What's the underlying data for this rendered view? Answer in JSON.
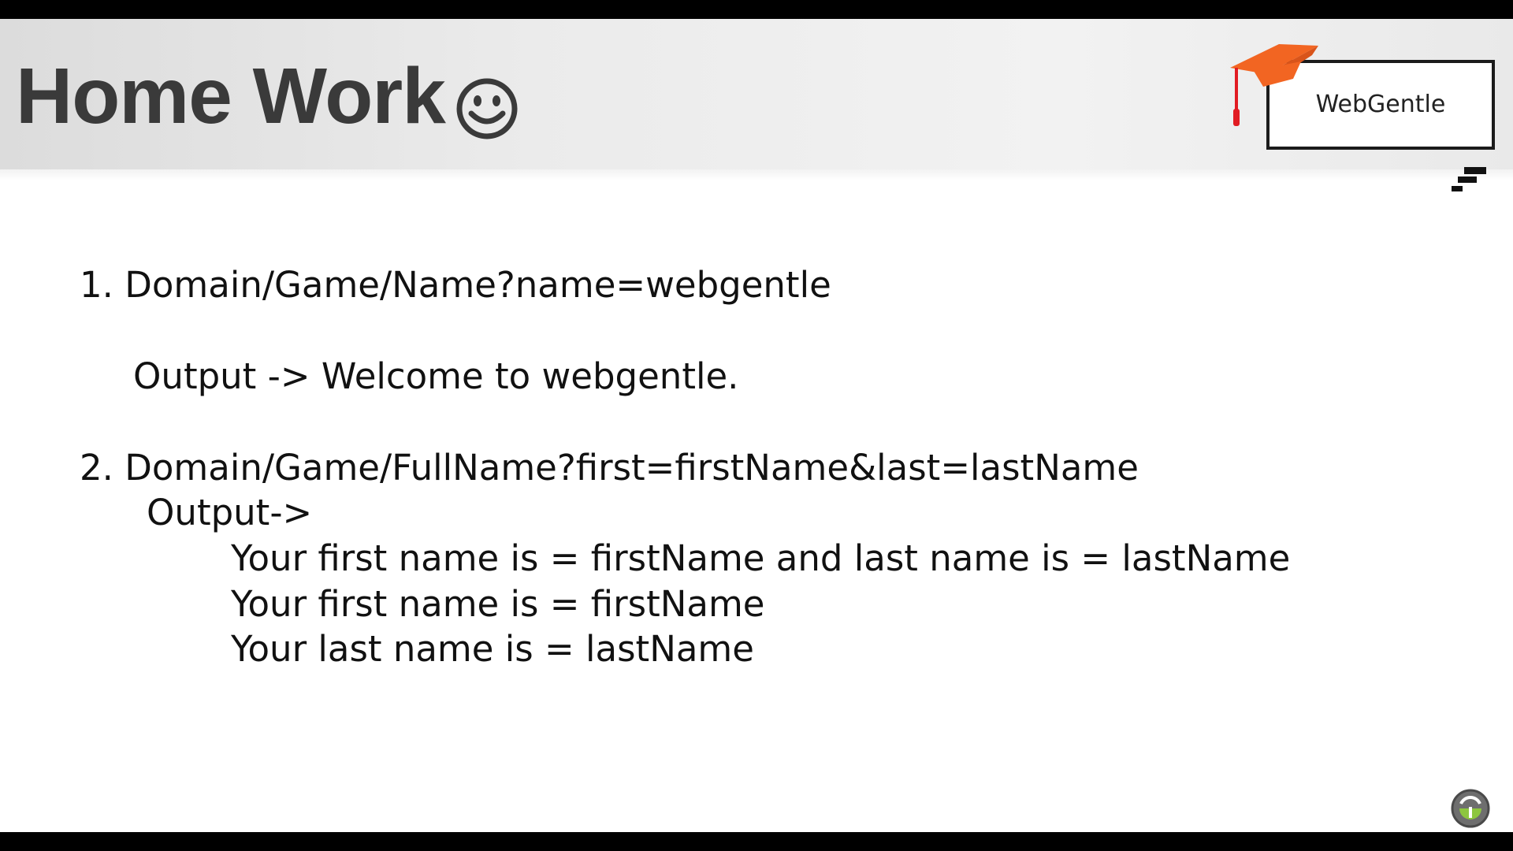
{
  "slide": {
    "title": "Home Work",
    "title_icon": "smiley-icon",
    "logo": {
      "text": "WebGentle",
      "icon": "graduation-cap-icon",
      "accent_color": "#f26522"
    },
    "items": [
      {
        "url": "1. Domain/Game/Name?name=webgentle",
        "output": "Output -> Welcome to webgentle."
      },
      {
        "url": "2. Domain/Game/FullName?first=firstName&last=lastName",
        "output": "Output->",
        "output_lines": [
          "Your first name is = firstName and last name is = lastName",
          "Your first name is = firstName",
          "Your last name is = lastName"
        ]
      }
    ],
    "corner_icon": "channel-logo-icon"
  }
}
